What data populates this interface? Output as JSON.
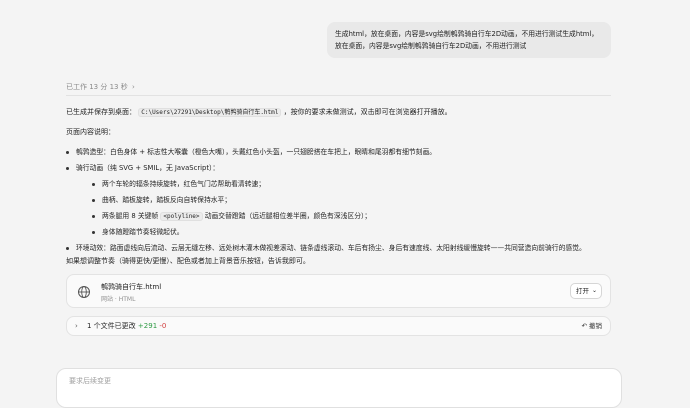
{
  "user_message": {
    "line1": "生成html，放在桌面，内容是svg绘制鹌鹑骑自行车2D动画，不用进行测试生成html，",
    "line2": "放在桌面，内容是svg绘制鹌鹑骑自行车2D动画，不用进行测试"
  },
  "worked": {
    "label": "已工作 13 分 13 秒",
    "chevron": "›"
  },
  "result": {
    "saved_prefix": "已生成并保存到桌面：",
    "path": "C:\\Users\\27291\\Desktop\\鹌鹑骑自行车.html",
    "saved_suffix": "，按你的要求未做测试，双击即可在浏览器打开播放。",
    "desc_title": "页面内容说明：",
    "bullets": [
      "鹌鹑造型：白色身体 + 标志性大喉囊（橙色大嘴），头戴红色小头盔，一只翅膀搭在车把上，眼睛和尾羽都有细节刻画。",
      "骑行动画（纯 SVG + SMIL，无 JavaScript）：",
      "两个车轮的辐条持续旋转，红色气门芯帮助看清转速；",
      "曲柄、踏板旋转，踏板反向自转保持水平；",
      "两条腿用 8 关键帧",
      "动画交替蹬踏（远近腿相位差半圈，颜色有深浅区分）；",
      "身体随蹬踏节奏轻微起伏。",
      "环境动效：路面虚线向后流动、云层无缝左移、远处树木灌木做视差滚动、链条虚线滚动、车后有扬尘、身后有速度线、太阳射线缓慢旋转——共同营造向前骑行的感觉。"
    ],
    "polyline_code": "<polyline>",
    "followup": "如果想调整节奏（骑得更快/更慢）、配色或者加上背景音乐按钮，告诉我即可。"
  },
  "file_card": {
    "icon": "globe-icon",
    "name": "鹌鹑骑自行车.html",
    "meta": "网站 · HTML",
    "open_label": "打开",
    "open_caret": "⌄"
  },
  "changes": {
    "chevron": "›",
    "label": "1 个文件已更改",
    "plus": "+291",
    "minus": "-0",
    "undo_label": "撤销",
    "undo_icon": "↶"
  },
  "composer": {
    "placeholder": "要求后续变更"
  }
}
